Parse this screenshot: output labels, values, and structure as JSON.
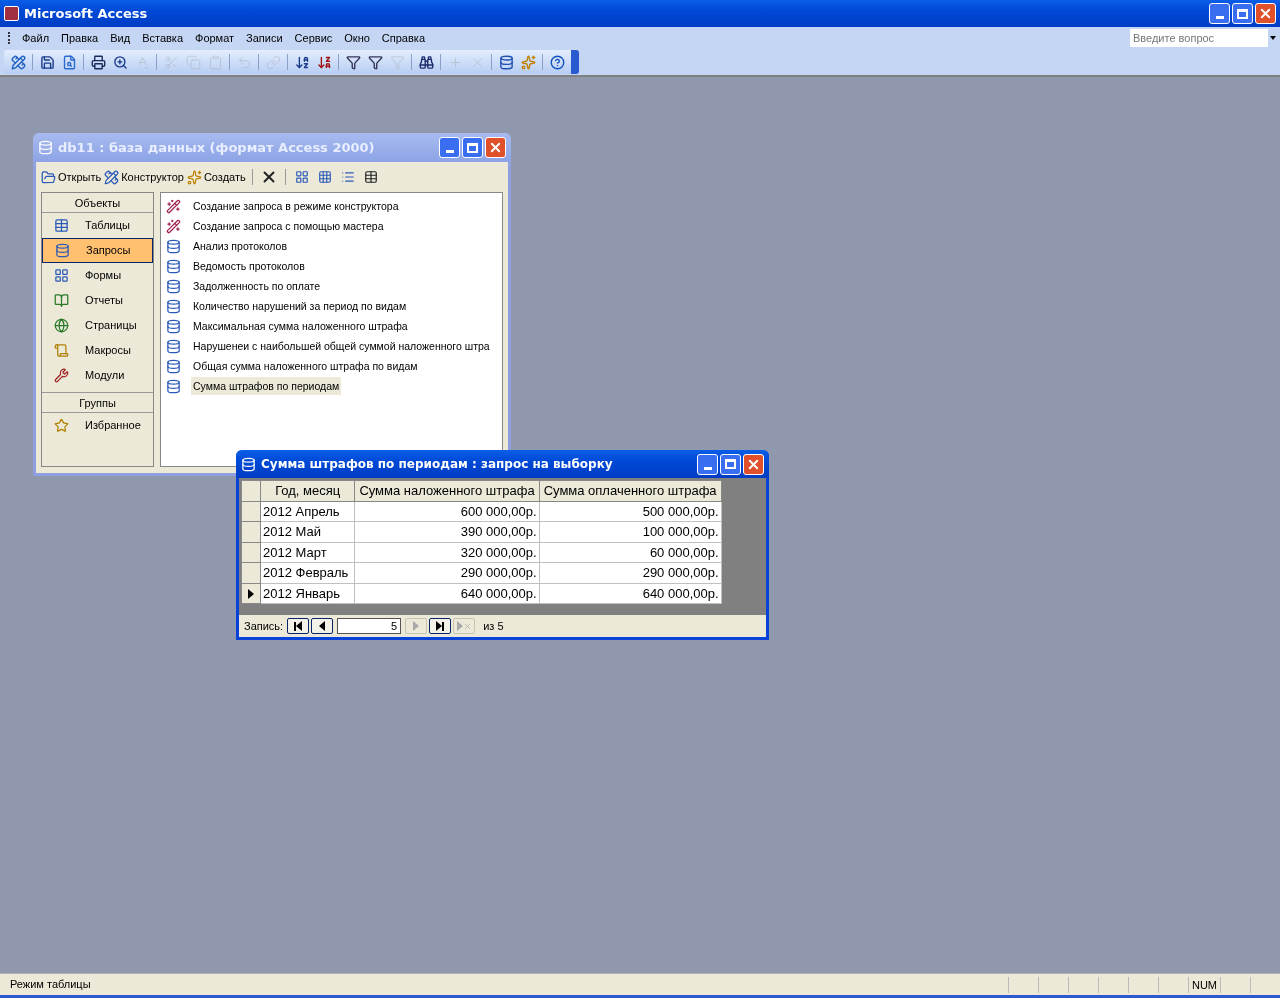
{
  "window": {
    "title": "Microsoft Access"
  },
  "menu": [
    "Файл",
    "Правка",
    "Вид",
    "Вставка",
    "Формат",
    "Записи",
    "Сервис",
    "Окно",
    "Справка"
  ],
  "help_box": {
    "placeholder": "Введите вопрос"
  },
  "toolbar": [
    {
      "kind": "design",
      "disabled": false
    },
    {
      "kind": "sep"
    },
    {
      "kind": "save",
      "disabled": false
    },
    {
      "kind": "preview",
      "disabled": false
    },
    {
      "kind": "sep"
    },
    {
      "kind": "print",
      "disabled": false
    },
    {
      "kind": "zoom",
      "disabled": false
    },
    {
      "kind": "spell",
      "disabled": true
    },
    {
      "kind": "sep"
    },
    {
      "kind": "cut",
      "disabled": true
    },
    {
      "kind": "copy",
      "disabled": true
    },
    {
      "kind": "paste",
      "disabled": true
    },
    {
      "kind": "sep"
    },
    {
      "kind": "undo",
      "disabled": true
    },
    {
      "kind": "sep"
    },
    {
      "kind": "link",
      "disabled": true
    },
    {
      "kind": "sep"
    },
    {
      "kind": "sortasc",
      "disabled": false
    },
    {
      "kind": "sortdesc",
      "disabled": false
    },
    {
      "kind": "sep"
    },
    {
      "kind": "filter",
      "disabled": false
    },
    {
      "kind": "filterform",
      "disabled": false
    },
    {
      "kind": "filterplain",
      "disabled": true
    },
    {
      "kind": "sep"
    },
    {
      "kind": "find",
      "disabled": false
    },
    {
      "kind": "sep"
    },
    {
      "kind": "newrec",
      "disabled": true
    },
    {
      "kind": "delrec",
      "disabled": true
    },
    {
      "kind": "sep"
    },
    {
      "kind": "dbwin",
      "disabled": false
    },
    {
      "kind": "newobj",
      "disabled": false
    },
    {
      "kind": "sep"
    },
    {
      "kind": "help",
      "disabled": false
    }
  ],
  "db_window": {
    "title": "db11 : база данных (формат Access 2000)",
    "actions": [
      {
        "kind": "open",
        "label": "Открыть"
      },
      {
        "kind": "design",
        "label": "Конструктор"
      },
      {
        "kind": "new",
        "label": "Создать"
      },
      {
        "kind": "sep"
      },
      {
        "kind": "delete"
      },
      {
        "kind": "sep"
      },
      {
        "kind": "large"
      },
      {
        "kind": "small"
      },
      {
        "kind": "list"
      },
      {
        "kind": "details"
      }
    ],
    "objects_header": "Объекты",
    "objects": [
      {
        "kind": "tables",
        "label": "Таблицы",
        "selected": false
      },
      {
        "kind": "queries",
        "label": "Запросы",
        "selected": true
      },
      {
        "kind": "forms",
        "label": "Формы",
        "selected": false
      },
      {
        "kind": "reports",
        "label": "Отчеты",
        "selected": false
      },
      {
        "kind": "pages",
        "label": "Страницы",
        "selected": false
      },
      {
        "kind": "macros",
        "label": "Макросы",
        "selected": false
      },
      {
        "kind": "modules",
        "label": "Модули",
        "selected": false
      }
    ],
    "groups_header": "Группы",
    "groups": [
      {
        "label": "Избранное"
      }
    ],
    "items": [
      {
        "kind": "wizard",
        "label": "Создание запроса в режиме конструктора",
        "selected": false
      },
      {
        "kind": "wizard",
        "label": "Создание запроса с помощью мастера",
        "selected": false
      },
      {
        "kind": "query",
        "label": "Анализ протоколов",
        "selected": false
      },
      {
        "kind": "query",
        "label": "Ведомость протоколов",
        "selected": false
      },
      {
        "kind": "query",
        "label": "Задолженность по оплате",
        "selected": false
      },
      {
        "kind": "query",
        "label": "Количество нарушений за период по видам",
        "selected": false
      },
      {
        "kind": "query",
        "label": "Максимальная сумма наложенного штрафа",
        "selected": false
      },
      {
        "kind": "query",
        "label": "Нарушенеи с наибольшей общей суммой наложенного штра",
        "selected": false
      },
      {
        "kind": "query",
        "label": "Общая сумма наложенного штрафа по видам",
        "selected": false
      },
      {
        "kind": "query",
        "label": "Сумма штрафов по периодам",
        "selected": true
      }
    ]
  },
  "query_window": {
    "title": "Сумма штрафов по периодам : запрос на выборку",
    "columns": [
      "Год, месяц",
      "Сумма наложенного штрафа",
      "Сумма оплаченного штрафа"
    ],
    "rows": [
      {
        "cells": [
          "2012 Апрель",
          "600 000,00р.",
          "500 000,00р."
        ],
        "selected": false
      },
      {
        "cells": [
          "2012 Май",
          "390 000,00р.",
          "100 000,00р."
        ],
        "selected": false
      },
      {
        "cells": [
          "2012 Март",
          "320 000,00р.",
          "60 000,00р."
        ],
        "selected": false
      },
      {
        "cells": [
          "2012 Февраль",
          "290 000,00р.",
          "290 000,00р."
        ],
        "selected": false
      },
      {
        "cells": [
          "2012 Январь",
          "640 000,00р.",
          "640 000,00р."
        ],
        "selected": true
      }
    ],
    "nav": {
      "label": "Запись:",
      "record": "5",
      "total": "из 5",
      "buttons": [
        {
          "kind": "first",
          "disabled": false
        },
        {
          "kind": "prev",
          "disabled": false
        },
        {
          "kind": "next",
          "disabled": true
        },
        {
          "kind": "last",
          "disabled": false
        },
        {
          "kind": "new",
          "disabled": true
        }
      ]
    }
  },
  "status_bar": {
    "text": "Режим таблицы",
    "indicator": "NUM"
  }
}
